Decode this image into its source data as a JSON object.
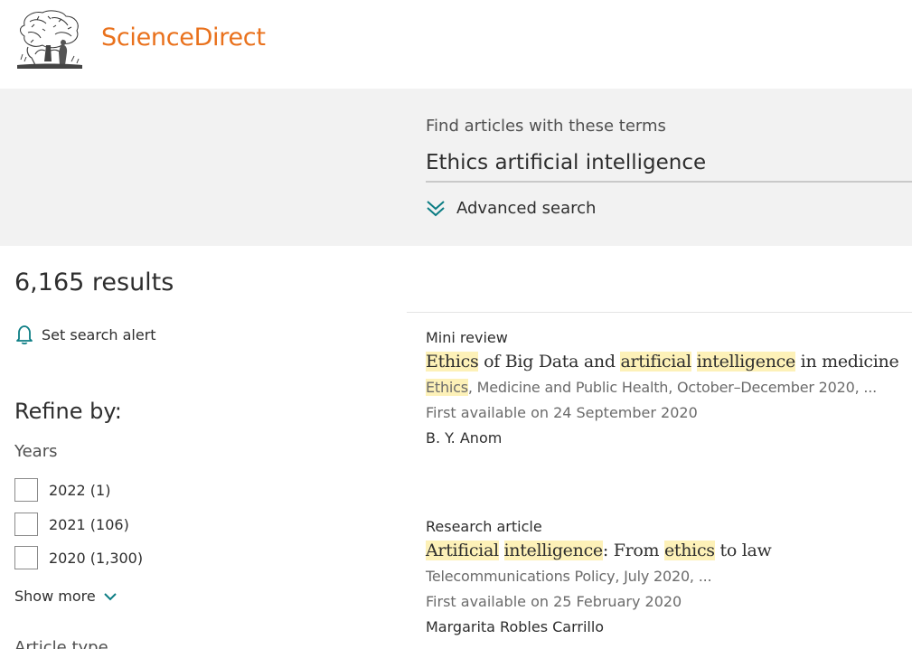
{
  "brand": {
    "name": "ScienceDirect",
    "color": "#e9711c"
  },
  "search": {
    "label": "Find articles with these terms",
    "value": "Ethics artificial intelligence",
    "advanced_label": "Advanced search",
    "accent": "#0c7d84"
  },
  "results": {
    "count_text": "6,165 results",
    "alert_label": "Set search alert",
    "highlight_color": "#fdf1b8",
    "items": [
      {
        "type": "Mini review",
        "title": {
          "w1": "Ethics",
          "t1": " of Big Data and ",
          "w2": "artificial",
          "t2": " ",
          "w3": "intelligence",
          "t3": " in medicine"
        },
        "source": {
          "w1": "Ethics",
          "t1": ", Medicine and Public Health, October–December 2020, ..."
        },
        "available": "First available on 24 September 2020",
        "authors": "B. Y. Anom"
      },
      {
        "type": "Research article",
        "title": {
          "w1": "Artificial",
          "t1": " ",
          "w2": "intelligence",
          "t2": ": From ",
          "w3": "ethics",
          "t3": " to law"
        },
        "source": "Telecommunications Policy, July 2020, ...",
        "available": "First available on 25 February 2020",
        "authors": "Margarita Robles Carrillo"
      }
    ]
  },
  "refine": {
    "title": "Refine by:",
    "years_title": "Years",
    "years": [
      {
        "label": "2022 (1)"
      },
      {
        "label": "2021 (106)"
      },
      {
        "label": "2020 (1,300)"
      }
    ],
    "show_more": "Show more",
    "next_heading": "Article type"
  },
  "icons": {
    "logo": "elsevier-tree-logo",
    "advanced": "double-chevron-down-icon",
    "alert": "bell-icon",
    "show_more": "chevron-down-icon"
  }
}
